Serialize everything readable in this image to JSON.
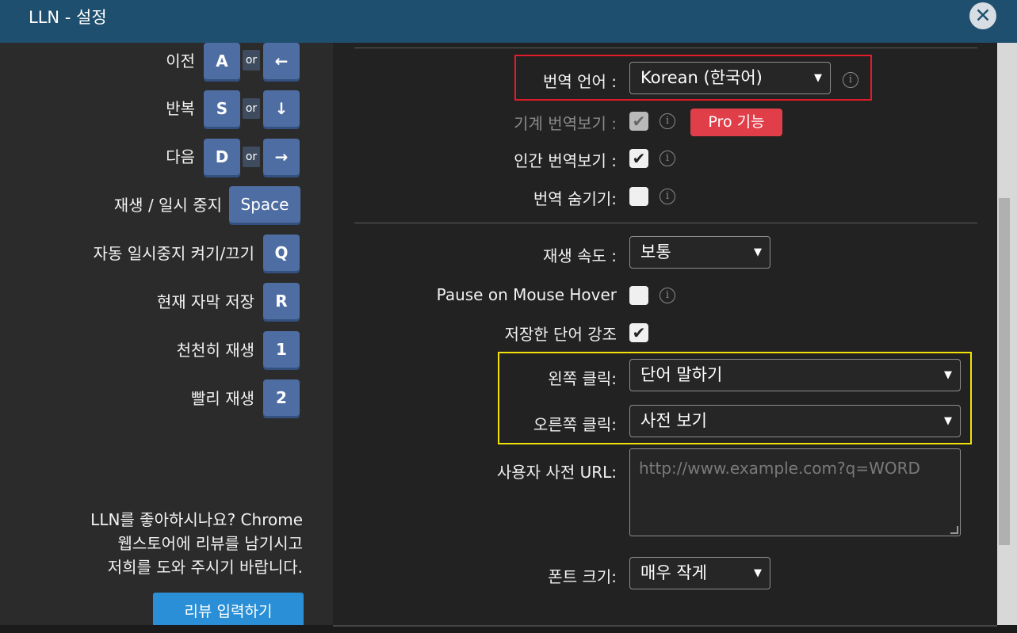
{
  "window": {
    "title": "LLN - 설정",
    "close_icon": "✕"
  },
  "hotkeys": [
    {
      "label": "이전",
      "key": "A",
      "or": "or",
      "alt": "←"
    },
    {
      "label": "반복",
      "key": "S",
      "or": "or",
      "alt": "↓"
    },
    {
      "label": "다음",
      "key": "D",
      "or": "or",
      "alt": "→"
    },
    {
      "label": "재생 / 일시 중지",
      "key": "Space"
    },
    {
      "label": "자동 일시중지 켜기/끄기",
      "key": "Q"
    },
    {
      "label": "현재 자막 저장",
      "key": "R"
    },
    {
      "label": "천천히 재생",
      "key": "1"
    },
    {
      "label": "빨리 재생",
      "key": "2"
    }
  ],
  "review": {
    "line1": "LLN를 좋아하시나요? Chrome",
    "line2": "웹스토어에 리뷰를 남기시고",
    "line3": "저희를 도와 주시기 바랍니다.",
    "button": "리뷰 입력하기"
  },
  "settings": {
    "translation_language": {
      "label": "번역 언어 :",
      "value": "Korean (한국어)"
    },
    "machine_translation": {
      "label": "기계 번역보기 :",
      "checked": true,
      "disabled": true,
      "pro_label": "Pro 기능"
    },
    "human_translation": {
      "label": "인간 번역보기 :",
      "checked": true
    },
    "hide_translation": {
      "label": "번역 숨기기:",
      "checked": false
    },
    "playback_speed": {
      "label": "재생 속도 :",
      "value": "보통"
    },
    "pause_on_hover": {
      "label": "Pause on Mouse Hover",
      "checked": false
    },
    "highlight_saved": {
      "label": "저장한 단어 강조",
      "checked": true
    },
    "left_click": {
      "label": "왼쪽 클릭:",
      "value": "단어 말하기"
    },
    "right_click": {
      "label": "오른쪽 클릭:",
      "value": "사전 보기"
    },
    "custom_dict": {
      "label": "사용자 사전 URL:",
      "placeholder": "http://www.example.com?q=WORD"
    },
    "font_size": {
      "label": "폰트 크기:",
      "value": "매우 작게"
    }
  },
  "icons": {
    "check": "✔",
    "info": "i",
    "caret": "▼"
  },
  "colors": {
    "titlebar": "#1f4f6e",
    "key": "#4e6da3",
    "pro": "#e03f4a",
    "review_button": "#2a8fd6",
    "highlight_red": "#e21b2a",
    "highlight_yellow": "#f2e20a"
  }
}
